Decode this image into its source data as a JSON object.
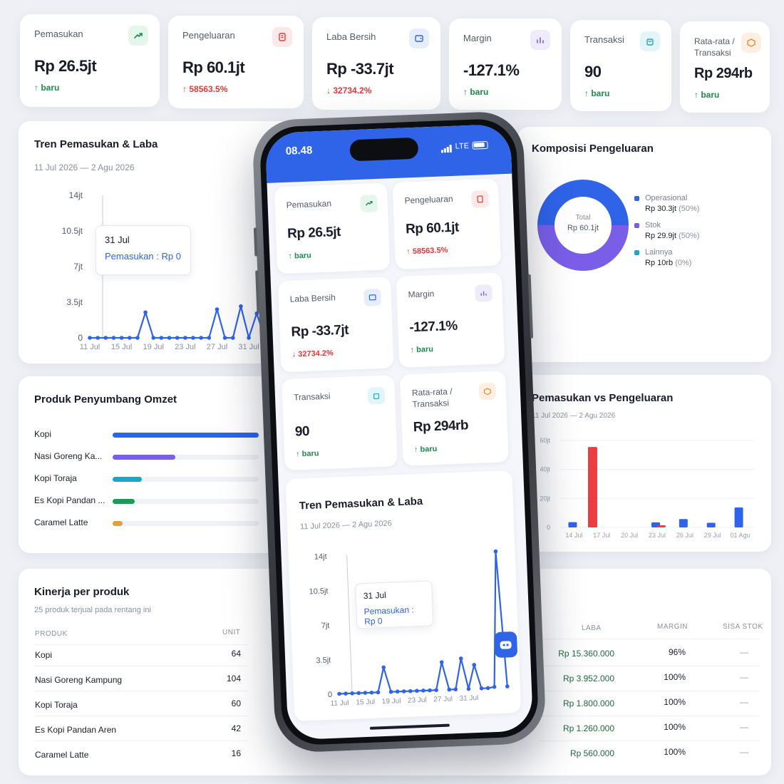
{
  "kpis": [
    {
      "label": "Pemasukan",
      "value": "Rp 26.5jt",
      "change": "baru",
      "direction": "up",
      "icon": "trend-up-icon"
    },
    {
      "label": "Pengeluaran",
      "value": "Rp 60.1jt",
      "change": "58563.5%",
      "direction": "up-bad",
      "icon": "receipt-icon"
    },
    {
      "label": "Laba Bersih",
      "value": "Rp -33.7jt",
      "change": "32734.2%",
      "direction": "down",
      "icon": "wallet-icon"
    },
    {
      "label": "Margin",
      "value": "-127.1%",
      "change": "baru",
      "direction": "up",
      "icon": "bar-chart-icon"
    },
    {
      "label": "Transaksi",
      "value": "90",
      "change": "baru",
      "direction": "up",
      "icon": "shopping-bag-icon"
    },
    {
      "label": "Rata-rata / Transaksi",
      "value": "Rp 294rb",
      "change": "baru",
      "direction": "up",
      "icon": "box-icon"
    }
  ],
  "trend": {
    "title": "Tren Pemasukan & Laba",
    "range": "11 Jul 2026 — 2 Agu 2026",
    "tooltip": {
      "date": "31 Jul",
      "series": "Pemasukan",
      "value": "Rp 0"
    }
  },
  "composition": {
    "title": "Komposisi Pengeluaran",
    "total_label": "Total",
    "total_value": "Rp 60.1jt",
    "items": [
      {
        "name": "Operasional",
        "value": "Rp 30.3jt",
        "pct": "(50%)",
        "color": "#2f63e8"
      },
      {
        "name": "Stok",
        "value": "Rp 29.9jt",
        "pct": "(50%)",
        "color": "#7a5ee8"
      },
      {
        "name": "Lainnya",
        "value": "Rp 10rb",
        "pct": "(0%)",
        "color": "#1ba6c7"
      }
    ]
  },
  "products": {
    "title": "Produk Penyumbang Omzet",
    "items": [
      {
        "name": "Kopi",
        "share": 1.0,
        "color": "#2f63e8"
      },
      {
        "name": "Nasi Goreng Ka...",
        "share": 0.43,
        "color": "#7a5ee8"
      },
      {
        "name": "Kopi Toraja",
        "share": 0.2,
        "color": "#1ba6c7"
      },
      {
        "name": "Es Kopi Pandan ...",
        "share": 0.15,
        "color": "#1e9a5a"
      },
      {
        "name": "Caramel Latte",
        "share": 0.07,
        "color": "#e0a03a"
      }
    ]
  },
  "income_vs_expense": {
    "title": "Pemasukan vs Pengeluaran",
    "range": "11 Jul 2026 — 2 Agu 2026"
  },
  "performance": {
    "title": "Kinerja per produk",
    "subtitle": "25 produk terjual pada rentang ini",
    "headers": {
      "product": "PRODUK",
      "unit": "UNIT",
      "profit": "LABA",
      "margin": "MARGIN",
      "stock": "SISA STOK"
    },
    "rows": [
      {
        "product": "Kopi",
        "unit": "64",
        "profit": "Rp 15.360.000",
        "margin": "96%",
        "stock": "—"
      },
      {
        "product": "Nasi Goreng Kampung",
        "unit": "104",
        "profit": "Rp 3.952.000",
        "margin": "100%",
        "stock": "—"
      },
      {
        "product": "Kopi Toraja",
        "unit": "60",
        "profit": "Rp 1.800.000",
        "margin": "100%",
        "stock": "—"
      },
      {
        "product": "Es Kopi Pandan Aren",
        "unit": "42",
        "profit": "Rp 1.260.000",
        "margin": "100%",
        "stock": "—"
      },
      {
        "product": "Caramel Latte",
        "unit": "16",
        "profit": "Rp 560.000",
        "margin": "100%",
        "stock": "—"
      }
    ]
  },
  "phone": {
    "time": "08.48",
    "network": "LTE"
  },
  "chart_data": [
    {
      "type": "line",
      "title": "Tren Pemasukan & Laba",
      "x": [
        "11 Jul",
        "12 Jul",
        "13 Jul",
        "14 Jul",
        "15 Jul",
        "16 Jul",
        "17 Jul",
        "18 Jul",
        "19 Jul",
        "20 Jul",
        "21 Jul",
        "22 Jul",
        "23 Jul",
        "24 Jul",
        "25 Jul",
        "26 Jul",
        "27 Jul",
        "28 Jul",
        "29 Jul",
        "30 Jul",
        "31 Jul",
        "1 Agu",
        "2 Agu"
      ],
      "xticks": [
        "11 Jul",
        "15 Jul",
        "19 Jul",
        "23 Jul",
        "27 Jul",
        "31 Jul"
      ],
      "yticks": [
        "0",
        "3.5jt",
        "7jt",
        "10.5jt",
        "14jt"
      ],
      "ylim": [
        0,
        14
      ],
      "series": [
        {
          "name": "Pemasukan",
          "values": [
            0,
            0,
            0,
            0,
            0,
            0,
            0,
            2.5,
            0,
            0,
            0,
            0,
            0,
            0,
            0,
            0,
            2.8,
            0,
            0,
            3.1,
            0,
            2.4,
            0,
            0,
            0.1,
            13.8,
            0.1
          ]
        }
      ]
    },
    {
      "type": "bar",
      "title": "Pemasukan vs Pengeluaran",
      "categories": [
        "14 Jul",
        "17 Jul",
        "20 Jul",
        "23 Jul",
        "26 Jul",
        "29 Jul",
        "01 Agu"
      ],
      "yticks": [
        "0",
        "20jt",
        "40jt",
        "60jt"
      ],
      "ylim": [
        0,
        60
      ],
      "series": [
        {
          "name": "Pemasukan",
          "color": "#2f63e8",
          "values": [
            3.6,
            0,
            0,
            3.5,
            5.8,
            3.2,
            13.8
          ]
        },
        {
          "name": "Pengeluaran",
          "color": "#e84040",
          "values": [
            0,
            0,
            0,
            1.5,
            0,
            0,
            0
          ]
        }
      ],
      "extra_bar": {
        "category_offset": 0.4,
        "value": 55.5
      }
    }
  ]
}
